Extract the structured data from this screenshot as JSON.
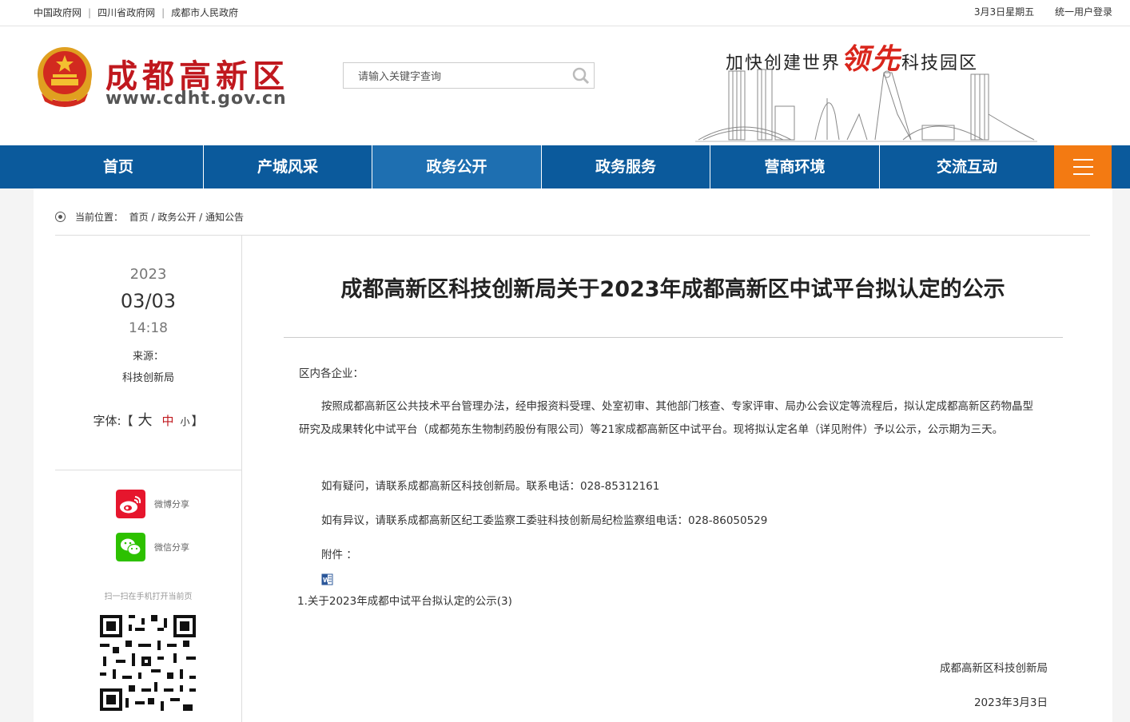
{
  "topbar": {
    "links": [
      "中国政府网",
      "四川省政府网",
      "成都市人民政府"
    ],
    "date": "3月3日星期五",
    "login": "统一用户登录"
  },
  "header": {
    "site_name": "成都高新区",
    "site_url": "www.cdht.gov.cn",
    "search_placeholder": "请输入关键字查询",
    "slogan_pre": "加快创建世界",
    "slogan_hl": "领先",
    "slogan_post": "科技园区"
  },
  "nav": {
    "items": [
      "首页",
      "产城风采",
      "政务公开",
      "政务服务",
      "营商环境",
      "交流互动"
    ],
    "active_index": 2
  },
  "breadcrumb": {
    "label": "当前位置：",
    "path": "首页 / 政务公开 / 通知公告"
  },
  "sidebar": {
    "year": "2023",
    "date": "03/03",
    "time": "14:18",
    "source_label": "来源：",
    "source": "科技创新局",
    "font_label": "字体:【",
    "font_big": "大",
    "font_mid": "中",
    "font_small": "小",
    "font_close": "】",
    "weibo": "微博分享",
    "wechat": "微信分享",
    "scan": "扫一扫在手机打开当前页"
  },
  "article": {
    "title": "成都高新区科技创新局关于2023年成都高新区中试平台拟认定的公示",
    "greeting": "区内各企业：",
    "para1": "按照成都高新区公共技术平台管理办法，经申报资料受理、处室初审、其他部门核查、专家评审、局办公会议定等流程后，拟认定成都高新区药物晶型研究及成果转化中试平台（成都苑东生物制药股份有限公司）等21家成都高新区中试平台。现将拟认定名单（详见附件）予以公示，公示期为三天。",
    "para2": "如有疑问，请联系成都高新区科技创新局。联系电话：028-85312161",
    "para3": "如有异议，请联系成都高新区纪工委监察工委驻科技创新局纪检监察组电话：028-86050529",
    "attachment_label": "附件 ：",
    "attachment_item": "1.关于2023年成都中试平台拟认定的公示(3)",
    "signature": "成都高新区科技创新局",
    "sign_date": "2023年3月3日"
  },
  "colors": {
    "nav_bg": "#0b5a9c",
    "nav_active": "#1e6fb1",
    "menu_orange": "#f37a12",
    "brand_red": "#c0181e"
  }
}
